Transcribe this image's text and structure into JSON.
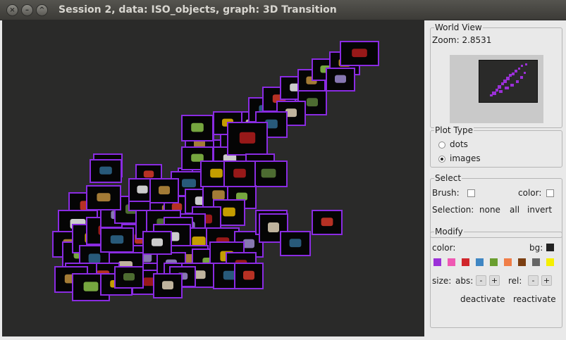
{
  "window": {
    "title": "Session 2, data: ISO_objects, graph: 3D Transition",
    "buttons": [
      "close",
      "minimize",
      "maximize"
    ]
  },
  "world_view": {
    "legend": "World View",
    "zoom_label": "Zoom: 2.8531"
  },
  "plot_type": {
    "legend": "Plot Type",
    "options": [
      {
        "label": "dots",
        "selected": false
      },
      {
        "label": "images",
        "selected": true
      }
    ]
  },
  "select": {
    "legend": "Select",
    "brush_label": "Brush:",
    "color_label": "color:",
    "selection_label": "Selection:",
    "none_label": "none",
    "all_label": "all",
    "invert_label": "invert"
  },
  "modify": {
    "legend": "Modify",
    "color_label": "color:",
    "bg_label": "bg:",
    "bg_color": "#222222",
    "palette": [
      "#9b30d8",
      "#ef58b3",
      "#d0262b",
      "#3f86c3",
      "#6a9e2f",
      "#f07e48",
      "#7c3f12",
      "#666666",
      "#f5ef00"
    ],
    "size_label": "size:",
    "abs_label": "abs:",
    "rel_label": "rel:",
    "minus_label": "-",
    "plus_label": "+",
    "deactivate_label": "deactivate",
    "reactivate_label": "reactivate"
  },
  "canvas": {
    "background": "#2a2a29",
    "item_border": "#8a2be2"
  }
}
